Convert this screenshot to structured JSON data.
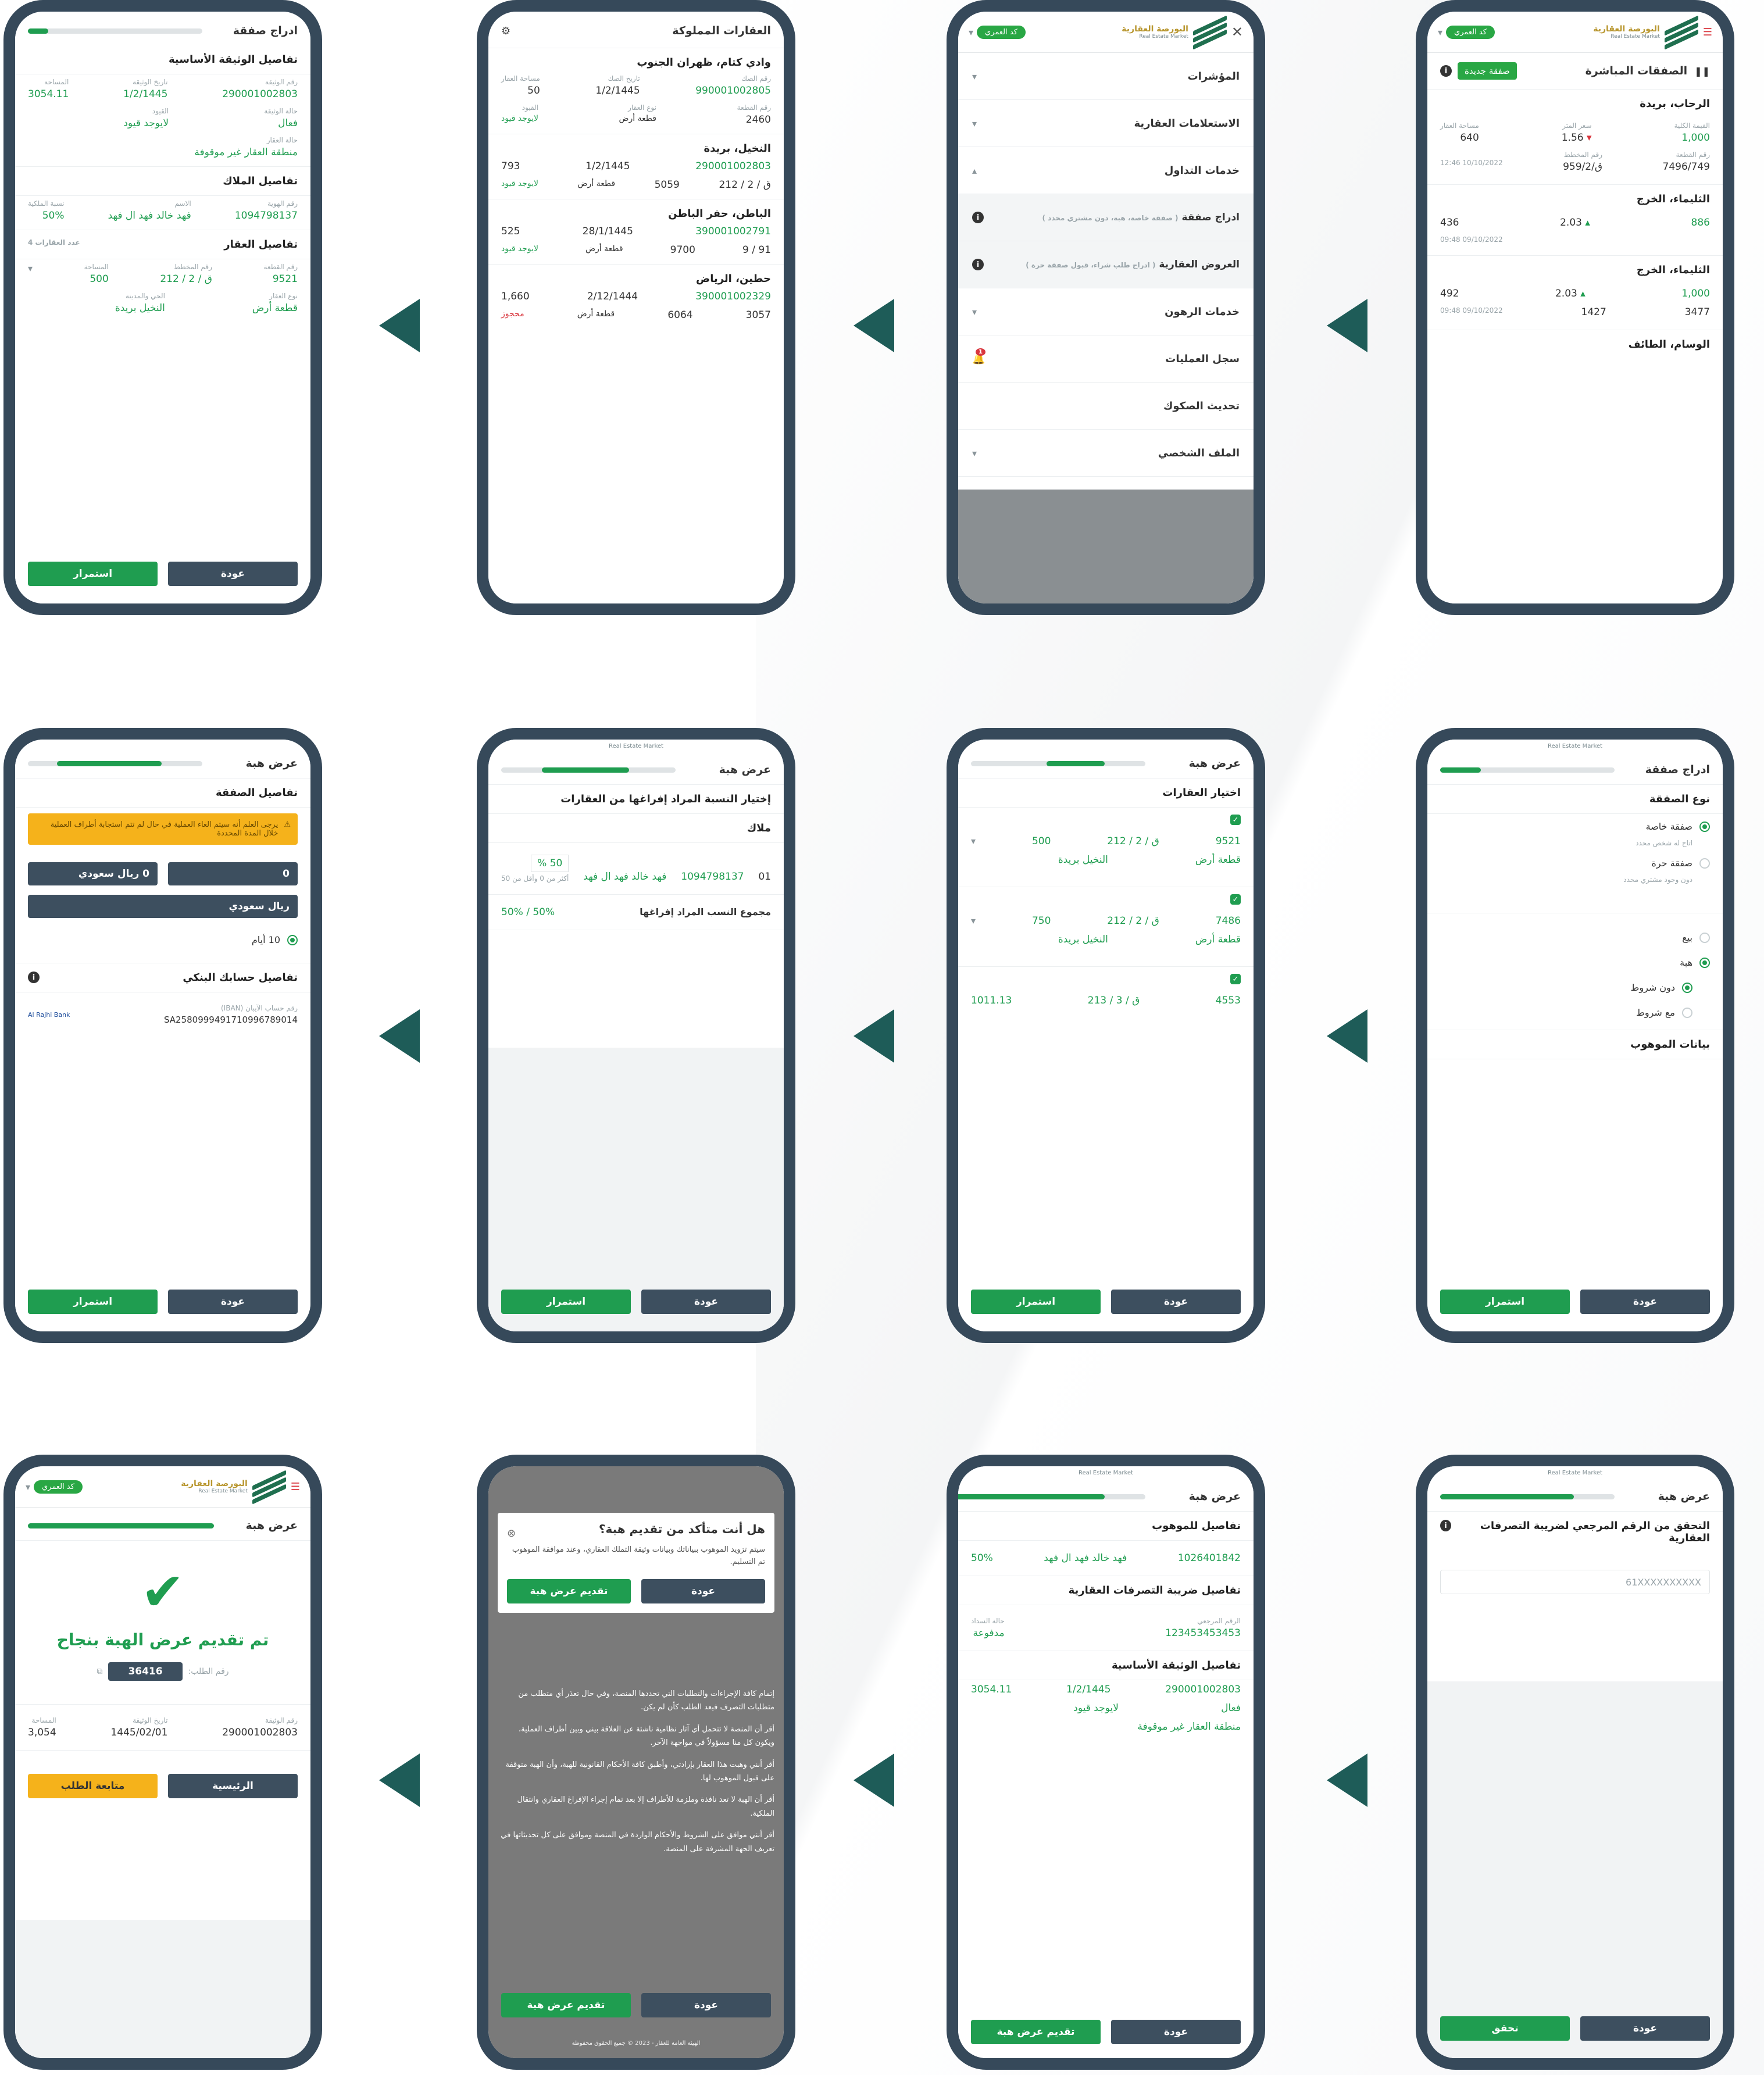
{
  "brand": {
    "name_ar": "البورصة العقارية",
    "name_en": "Real Estate Market",
    "user_pill": "كد العمري"
  },
  "screens": {
    "s1": {
      "title": "الصفقات المباشرة",
      "new_deal": "صفقة جديدة",
      "deals": [
        {
          "city": "الرحاب، بريدة",
          "area_lbl": "مساحة العقار",
          "area": "640",
          "price_lbl": "سعر المتر",
          "change": "1.56",
          "total_lbl": "القيمة الكلية",
          "total": "1,000",
          "date": "10/10/2022 12:46",
          "plan_lbl": "رقم المخطط",
          "plan": "ق/959/2",
          "parcel_lbl": "رقم القطعة",
          "parcel": "7496/749"
        },
        {
          "city": "الثليماء، الخرج",
          "area": "436",
          "change": "2.03",
          "total": "886",
          "date": "09/10/2022 09:48"
        },
        {
          "city": "الثليماء، الخرج",
          "area": "492",
          "change": "2.03",
          "total": "1,000",
          "date": "09/10/2022 09:48",
          "plan": "1427",
          "parcel": "3477"
        },
        {
          "city": "الوسام، الطائف"
        }
      ]
    },
    "s2": {
      "menu": [
        {
          "label": "المؤشرات",
          "expanded": false
        },
        {
          "label": "الاستعلامات العقارية",
          "expanded": false
        },
        {
          "label": "خدمات التداول",
          "expanded": true
        },
        {
          "label": "ادراج صفقة",
          "note": "( صفقة خاصة، هبة، دون مشتري محدد )",
          "sub": true
        },
        {
          "label": "العروض العقارية",
          "note": "( ادراج طلب شراء، قبول صفقة حرة )",
          "sub": true
        },
        {
          "label": "خدمات الرهون",
          "expanded": false
        },
        {
          "label": "سجل العمليات",
          "badge": "1"
        },
        {
          "label": "تحديث الصكوك"
        },
        {
          "label": "الملف الشخصي",
          "expanded": false
        }
      ]
    },
    "s3": {
      "title": "العقارات المملوكة",
      "items": [
        {
          "city": "وادي كتام، ظهران الجنوب",
          "lbl_deed": "رقم الصك",
          "deed": "990001002805",
          "lbl_date": "تاريخ الصك",
          "date": "1/2/1445",
          "lbl_area": "مساحة العقار",
          "area": "50",
          "lbl_parcel": "رقم القطعة",
          "parcel": "2460",
          "lbl_type": "نوع العقار",
          "type": "قطعة أرض",
          "lbl_restr": "القيود",
          "restr": "لايوجد قيود"
        },
        {
          "city": "النخيل، بريدة",
          "deed": "290001002803",
          "date": "1/2/1445",
          "area": "793",
          "parcel": "5059",
          "plan": "ق / 2 / 212",
          "type": "قطعة أرض",
          "restr": "لايوجد قيود"
        },
        {
          "city": "الباطن، حفر الباطن",
          "deed": "390001002791",
          "date": "28/1/1445",
          "area": "525",
          "parcel": "9700",
          "plan": "91 / 9",
          "type": "قطعة أرض",
          "restr": "لايوجد قيود"
        },
        {
          "city": "حطين، الرياض",
          "deed": "390001002329",
          "date": "2/12/1444",
          "area": "1,660",
          "parcel": "6064",
          "plan": "3057",
          "type": "قطعة أرض",
          "restr": "محجوز"
        }
      ]
    },
    "s4": {
      "title": "ادراج صفقة",
      "doc_section": "تفاصيل الوثيقة الأساسية",
      "doc_no_lbl": "رقم الوثيقة",
      "doc_no": "290001002803",
      "doc_date_lbl": "تاريخ الوثيقة",
      "doc_date": "1/2/1445",
      "area_lbl": "المساحة",
      "area": "3054.11",
      "status_lbl": "حالة الوثيقة",
      "status": "فعال",
      "restr_lbl": "القيود",
      "restr": "لايوجد قيود",
      "prop_status_lbl": "حالة العقار",
      "prop_status": "منطقة العقار غير موقوفة",
      "owners_section": "تفاصيل الملاك",
      "owner_id_lbl": "رقم الهوية",
      "owner_id": "1094798137",
      "owner_name_lbl": "الاسم",
      "owner_name": "فهد خالد فهد ال فهد",
      "owner_pct_lbl": "نسبة الملكية",
      "owner_pct": "50%",
      "prop_section": "تفاصيل العقار",
      "prop_count": "عدد العقارات 4",
      "parcel_lbl": "رقم القطعة",
      "parcel": "9521",
      "plan_lbl": "رقم المخطط",
      "plan": "ق / 2 / 212",
      "parea": "500",
      "ptype_lbl": "نوع العقار",
      "ptype": "قطعة أرض",
      "district_lbl": "الحي والمدينة",
      "district": "النخيل بريدة"
    },
    "s5": {
      "title": "ادراج صفقة",
      "type_section": "نوع الصفقة",
      "opt_private": "صفقة خاصة",
      "opt_private_sub": "اتاح له شخص محدد",
      "opt_free": "صفقة حرة",
      "opt_free_sub": "دون وجود مشتري محدد",
      "opt_sale": "بيع",
      "opt_gift": "هبة",
      "opt_no_cond": "دون شروط",
      "opt_cond": "مع شروط",
      "recipient_section": "بيانات الموهوب"
    },
    "s6": {
      "title": "عرض هبة",
      "section": "اختيار العقارات",
      "props": [
        {
          "parcel": "9521",
          "plan": "ق / 2 / 212",
          "area": "500",
          "type": "قطعة أرض",
          "district": "النخيل بريدة"
        },
        {
          "parcel": "7486",
          "plan": "ق / 2 / 212",
          "area": "750",
          "type": "قطعة أرض",
          "district": "النخيل بريدة"
        },
        {
          "parcel": "4553",
          "plan": "ق / 3 / 213",
          "area": "1011.13"
        }
      ]
    },
    "s7": {
      "title": "عرض هبة",
      "section": "إختيار النسبة المراد إفراغها من العقارات",
      "owners": "ملاك",
      "idx": "01",
      "owner_id": "1094798137",
      "owner_name": "فهد خالد فهد ال فهد",
      "pct": "50 %",
      "hint": "أكثر من 0 وأقل من 50",
      "total_lbl": "مجموع النسب المراد إفراغها",
      "total": "50% / 50%"
    },
    "s8": {
      "title": "عرض هبة",
      "section": "تفاصيل الصفقة",
      "notice": "يرجى العلم أنه سيتم الغاء العملية في حال لم تتم استجابة أطراف العملية خلال المدة المحددة",
      "amount_right": "0",
      "amount_left": "0 ريال سعودي",
      "currency": "ريال سعودي",
      "duration": "10 أيام",
      "bank_section": "تفاصيل حسابك البنكي",
      "iban_lbl": "رقم حساب الآيبان (IBAN)",
      "iban": "SA2580999491710996789014",
      "bank": "Al Rajhi Bank"
    },
    "s9": {
      "title": "عرض هبة",
      "section": "التحقق من الرقم المرجعي لضريبة التصرفات العقارية",
      "placeholder": "61XXXXXXXXXX",
      "verify": "تحقق"
    },
    "s10": {
      "title": "عرض هبة",
      "recipient_section": "تفاصيل للموهوب",
      "rid": "1026401842",
      "rname": "فهد خالد فهد ال فهد",
      "rpct": "50%",
      "tax_section": "تفاصيل ضريبة التصرفات العقارية",
      "tax_ref_lbl": "الرقم المرجعي",
      "tax_ref": "123453453453",
      "tax_status_lbl": "حالة السداد",
      "tax_status": "مدفوعة",
      "doc_section": "تفاصيل الوثيقة الأساسية",
      "doc_no": "290001002803",
      "doc_date": "1/2/1445",
      "area": "3054.11",
      "status": "فعال",
      "restr": "لايوجد قيود",
      "prop_status": "منطقة العقار غير موقوفة",
      "submit": "تقديم عرض هبة"
    },
    "s11": {
      "modal_title": "هل أنت متأكد من تقديم هبة؟",
      "modal_text": "سيتم تزويد الموهوب ببياناتك وبيانات وثيقة التملك العقاري، وعند موافقة الموهوب تم التسليم.",
      "modal_confirm": "تقديم عرض هبة",
      "terms": [
        "إتمام كافة الإجراءات والتطلبات التي تحددها المنصة، وفي حال تعذر أي متطلب من متطلبات التصرف فيعد الطلب كأن لم يكن.",
        "أقر أن المنصة لا تتحمل أي آثار نظامية ناشئة عن العلاقة بيني وبين أطراف العملية، ويكون كل منا مسؤولاً في مواجهة الآخر.",
        "أقر أنني وهبت هذا العقار بإرادتي، وأطبق كافة الأحكام القانونية للهبة، وأن الهبة متوقفة على قبول الموهوب لها.",
        "أقر أن الهبة لا تعد نافذة وملزمة للأطراف إلا بعد تمام إجراء الإفراغ العقاري وانتقال الملكية.",
        "أقر أنني موافق على الشروط والأحكام الواردة في المنصة وموافق على كل تحديثاتها في تعريف الجهة المشرفة على المنصة."
      ],
      "footer": "الهيئة العامة للعقار - 2023 © جميع الحقوق محفوظة"
    },
    "s12": {
      "title": "عرض هبة",
      "success": "تم تقديم عرض الهبة بنجاح",
      "ref_lbl": "رقم الطلب:",
      "ref": "36416",
      "doc_no_lbl": "رقم الوثيقة",
      "doc_no": "290001002803",
      "doc_date_lbl": "تاريخ الوثيقة",
      "doc_date": "1445/02/01",
      "area_lbl": "المساحة",
      "area": "3,054",
      "home": "الرئيسية",
      "track": "متابعة الطلب"
    }
  },
  "buttons": {
    "back": "عودة",
    "continue": "استمرار"
  },
  "colors": {
    "green": "#1f9d50",
    "dark": "#36495a",
    "arrow": "#1e5c58",
    "yellow": "#f5b21b"
  }
}
